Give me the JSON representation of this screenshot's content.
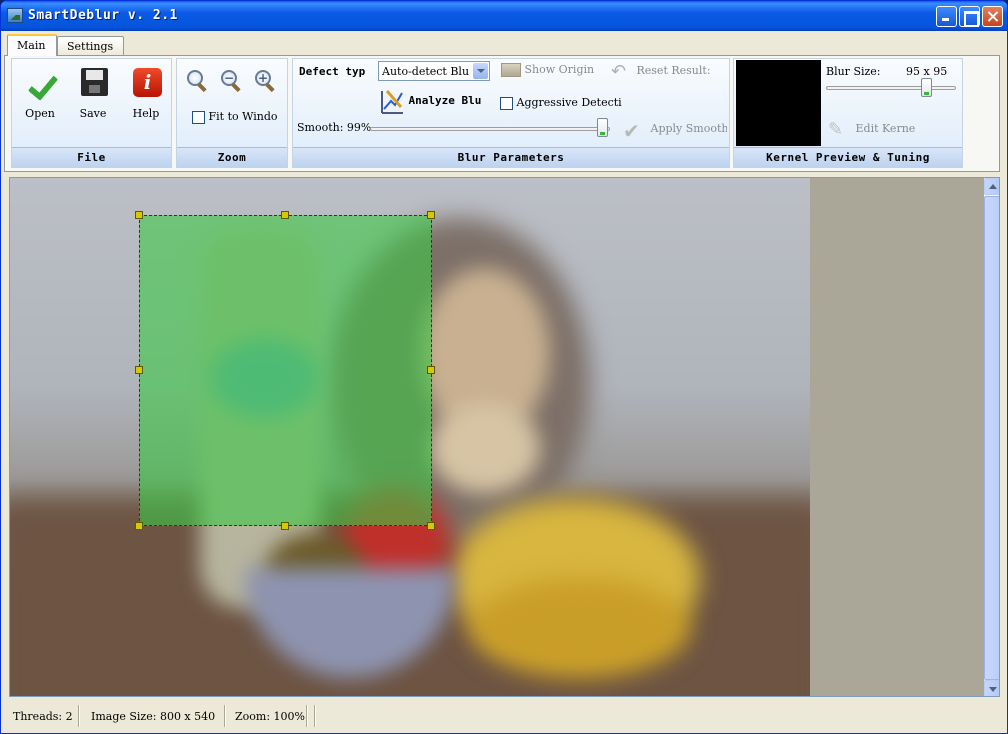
{
  "window": {
    "title": "SmartDeblur v. 2.1"
  },
  "tabs": [
    {
      "label": "Main",
      "active": true
    },
    {
      "label": "Settings",
      "active": false
    }
  ],
  "file_group": {
    "label": "File",
    "buttons": [
      {
        "label": "Open",
        "icon": "green-checkmark-icon"
      },
      {
        "label": "Save",
        "icon": "floppy-disk-icon"
      },
      {
        "label": "Help",
        "icon": "info-icon"
      }
    ]
  },
  "zoom_group": {
    "label": "Zoom",
    "icons": [
      "zoom-fit-icon",
      "zoom-out-icon",
      "zoom-in-icon"
    ],
    "fit_to_window": {
      "label": "Fit to Windo",
      "checked": false
    }
  },
  "blur_group": {
    "label": "Blur Parameters",
    "defect_type_label": "Defect typ",
    "defect_type_value": "Auto-detect Blu",
    "show_original": "Show Origin",
    "reset_results": "Reset Result:",
    "analyze_blur": "Analyze Blu",
    "aggressive_detection": {
      "label": "Aggressive Detecti",
      "checked": false
    },
    "smooth_label": "Smooth: 99%",
    "smooth_value": 99,
    "apply_smooth": "Apply Smooth"
  },
  "kernel_group": {
    "label": "Kernel Preview & Tuning",
    "blur_size_label": "Blur Size:",
    "blur_size_value": "95 x 95",
    "blur_size_fraction": 0.8,
    "edit_kernel": "Edit Kerne"
  },
  "status": {
    "threads": "Threads: 2",
    "image_size": "Image Size: 800 x 540",
    "zoom": "Zoom: 100%"
  },
  "colors": {
    "selection": "#3cc846",
    "title_bar": "#0a5ae6",
    "ribbon_group": "#dcebfa"
  }
}
